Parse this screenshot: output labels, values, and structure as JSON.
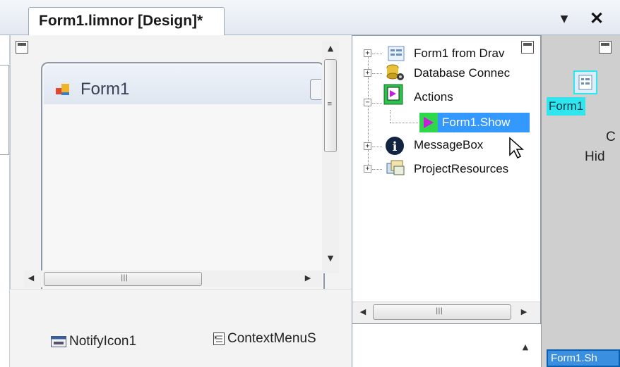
{
  "document_tab": {
    "title": "Form1.limnor [Design]*",
    "dropdown_glyph": "▼",
    "close_glyph": "✕"
  },
  "designer": {
    "form_title": "Form1",
    "tray_items": [
      {
        "label": "NotifyIcon1",
        "icon": "notify-icon"
      },
      {
        "label": "ContextMenuS",
        "icon": "context-menu-icon"
      }
    ]
  },
  "tree": {
    "nodes": [
      {
        "label": "Form1 from Drav",
        "icon": "form-icon",
        "expander": "+"
      },
      {
        "label": "Database Connec",
        "icon": "database-icon",
        "expander": "+"
      },
      {
        "label": "Actions",
        "icon": "actions-icon",
        "expander": "−"
      },
      {
        "label": "Form1.Show",
        "icon": "action-arrow-icon",
        "selected": true
      },
      {
        "label": "MessageBox",
        "icon": "info-icon",
        "expander": "+"
      },
      {
        "label": "ProjectResources",
        "icon": "resources-icon",
        "expander": "+"
      }
    ]
  },
  "right_panel": {
    "component_label": "Form1",
    "text_c": "C",
    "text_hide": "Hid",
    "bottom_tag": "Form1.Sh"
  },
  "colors": {
    "selection": "#3399ff",
    "highlight_cyan": "#2fe6ef",
    "panel_gray": "#cfcfcf"
  }
}
